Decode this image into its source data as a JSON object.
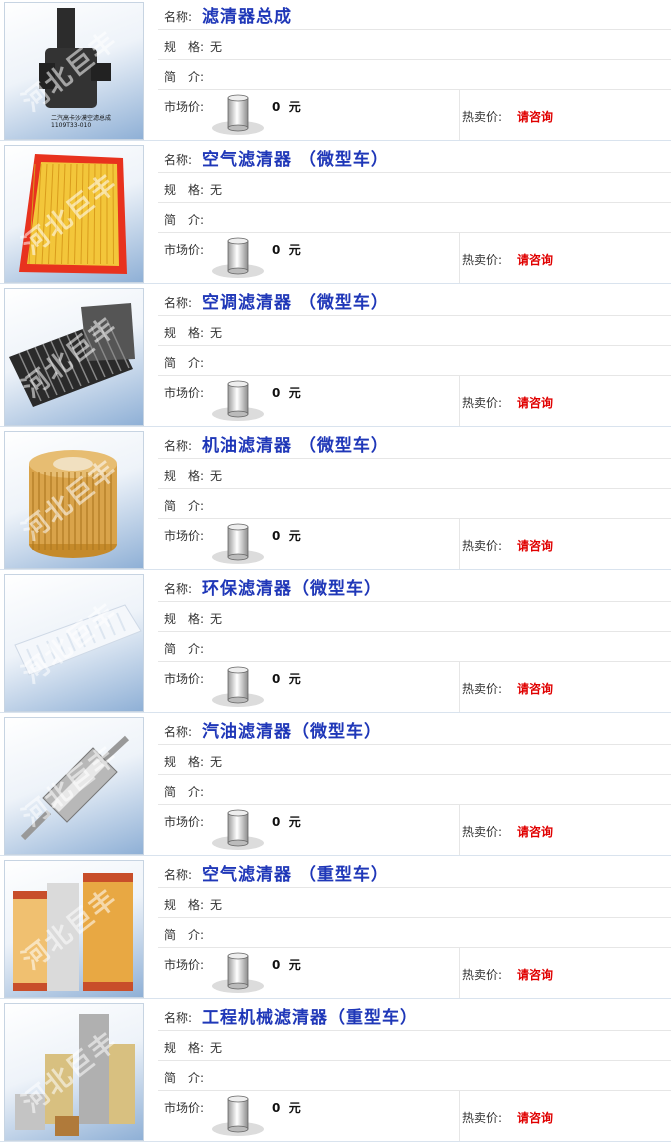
{
  "labels": {
    "name": "名称:",
    "spec": "规　格:",
    "intro": "简　介:",
    "market_price": "市场价:",
    "hot_price": "热卖价:"
  },
  "watermark": "河北巨丰",
  "products": [
    {
      "name": "滤清器总成",
      "spec": "无",
      "intro": "",
      "market_price": "0",
      "unit": "元",
      "hot_price": "请咨询",
      "caption": "二汽高卡沙漠空滤总成 1109T33-010",
      "image_icon": "air-filter-assembly-icon"
    },
    {
      "name": "空气滤清器 （微型车）",
      "spec": "无",
      "intro": "",
      "market_price": "0",
      "unit": "元",
      "hot_price": "请咨询",
      "image_icon": "panel-air-filter-icon"
    },
    {
      "name": "空调滤清器 （微型车）",
      "spec": "无",
      "intro": "",
      "market_price": "0",
      "unit": "元",
      "hot_price": "请咨询",
      "image_icon": "cabin-filter-icon"
    },
    {
      "name": "机油滤清器 （微型车）",
      "spec": "无",
      "intro": "",
      "market_price": "0",
      "unit": "元",
      "hot_price": "请咨询",
      "image_icon": "oil-filter-element-icon"
    },
    {
      "name": "环保滤清器（微型车）",
      "spec": "无",
      "intro": "",
      "market_price": "0",
      "unit": "元",
      "hot_price": "请咨询",
      "image_icon": "eco-filter-icon"
    },
    {
      "name": "汽油滤清器（微型车）",
      "spec": "无",
      "intro": "",
      "market_price": "0",
      "unit": "元",
      "hot_price": "请咨询",
      "image_icon": "fuel-filter-icon"
    },
    {
      "name": "空气滤清器 （重型车）",
      "spec": "无",
      "intro": "",
      "market_price": "0",
      "unit": "元",
      "hot_price": "请咨询",
      "image_icon": "heavy-air-filter-icon"
    },
    {
      "name": "工程机械滤清器（重型车）",
      "spec": "无",
      "intro": "",
      "market_price": "0",
      "unit": "元",
      "hot_price": "请咨询",
      "image_icon": "machinery-filter-icon"
    }
  ],
  "colors": {
    "name": "#1f37b8",
    "hot_price": "#e00000",
    "row_border": "#e6e6e6"
  }
}
